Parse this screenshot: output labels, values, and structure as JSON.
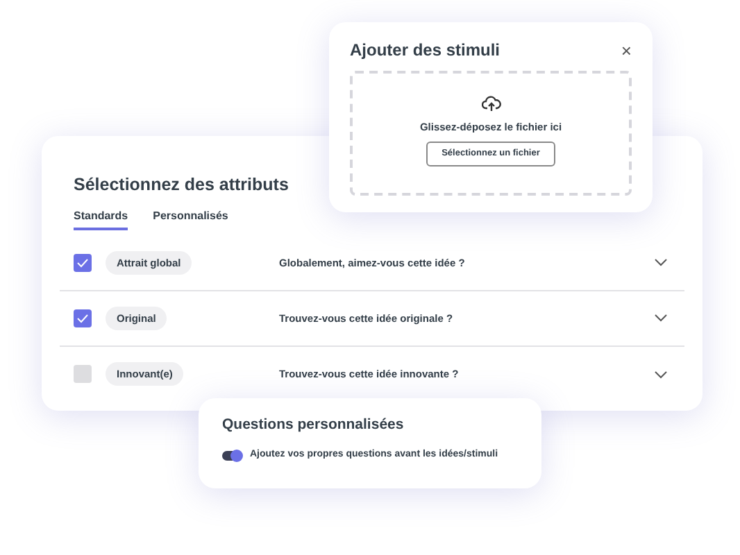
{
  "attributes_panel": {
    "title": "Sélectionnez des attributs",
    "tabs": [
      {
        "label": "Standards",
        "selected": true
      },
      {
        "label": "Personnalisés",
        "selected": false
      }
    ],
    "rows": [
      {
        "checked": true,
        "attribute": "Attrait global",
        "question": "Globalement, aimez-vous cette idée ?"
      },
      {
        "checked": true,
        "attribute": "Original",
        "question": "Trouvez-vous cette idée originale ?"
      },
      {
        "checked": false,
        "attribute": "Innovant(e)",
        "question": "Trouvez-vous cette idée innovante ?"
      }
    ]
  },
  "stimuli_dialog": {
    "title": "Ajouter des stimuli",
    "close": "×",
    "drop_text": "Glissez-déposez le fichier ici",
    "button": "Sélectionnez un fichier"
  },
  "custom_questions": {
    "title": "Questions personnalisées",
    "toggle": {
      "on": true,
      "label": "Ajoutez vos propres questions avant les idées/stimuli"
    }
  }
}
